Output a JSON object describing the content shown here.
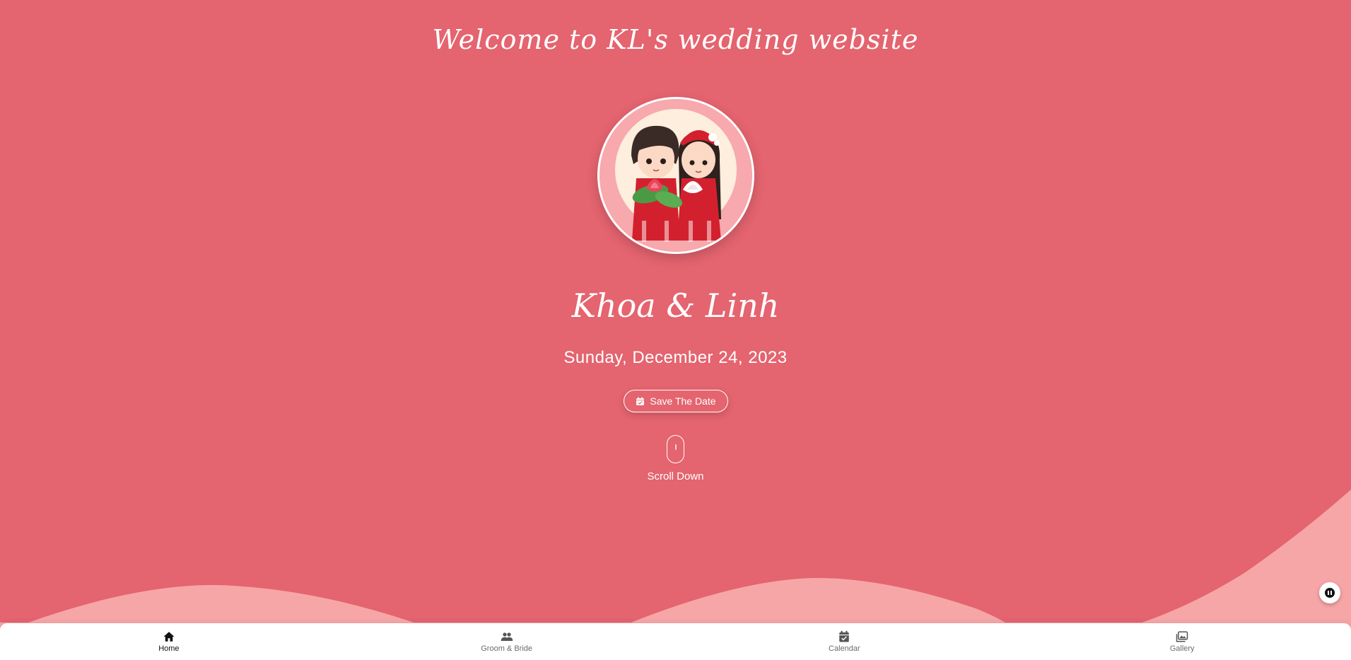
{
  "hero": {
    "welcome_title": "Welcome to KL's wedding website",
    "couple_names": "Khoa & Linh",
    "date": "Sunday, December 24, 2023",
    "save_button_label": "Save The Date",
    "scroll_label": "Scroll Down"
  },
  "bottom_nav": {
    "items": [
      {
        "label": "Home",
        "icon": "home-icon",
        "active": true
      },
      {
        "label": "Groom & Bride",
        "icon": "people-icon",
        "active": false
      },
      {
        "label": "Calendar",
        "icon": "calendar-icon",
        "active": false
      },
      {
        "label": "Gallery",
        "icon": "gallery-icon",
        "active": false
      }
    ]
  },
  "colors": {
    "background": "#e4646f",
    "wave": "#f7a6a8",
    "text": "#ffffff",
    "nav_background": "#ffffff"
  }
}
